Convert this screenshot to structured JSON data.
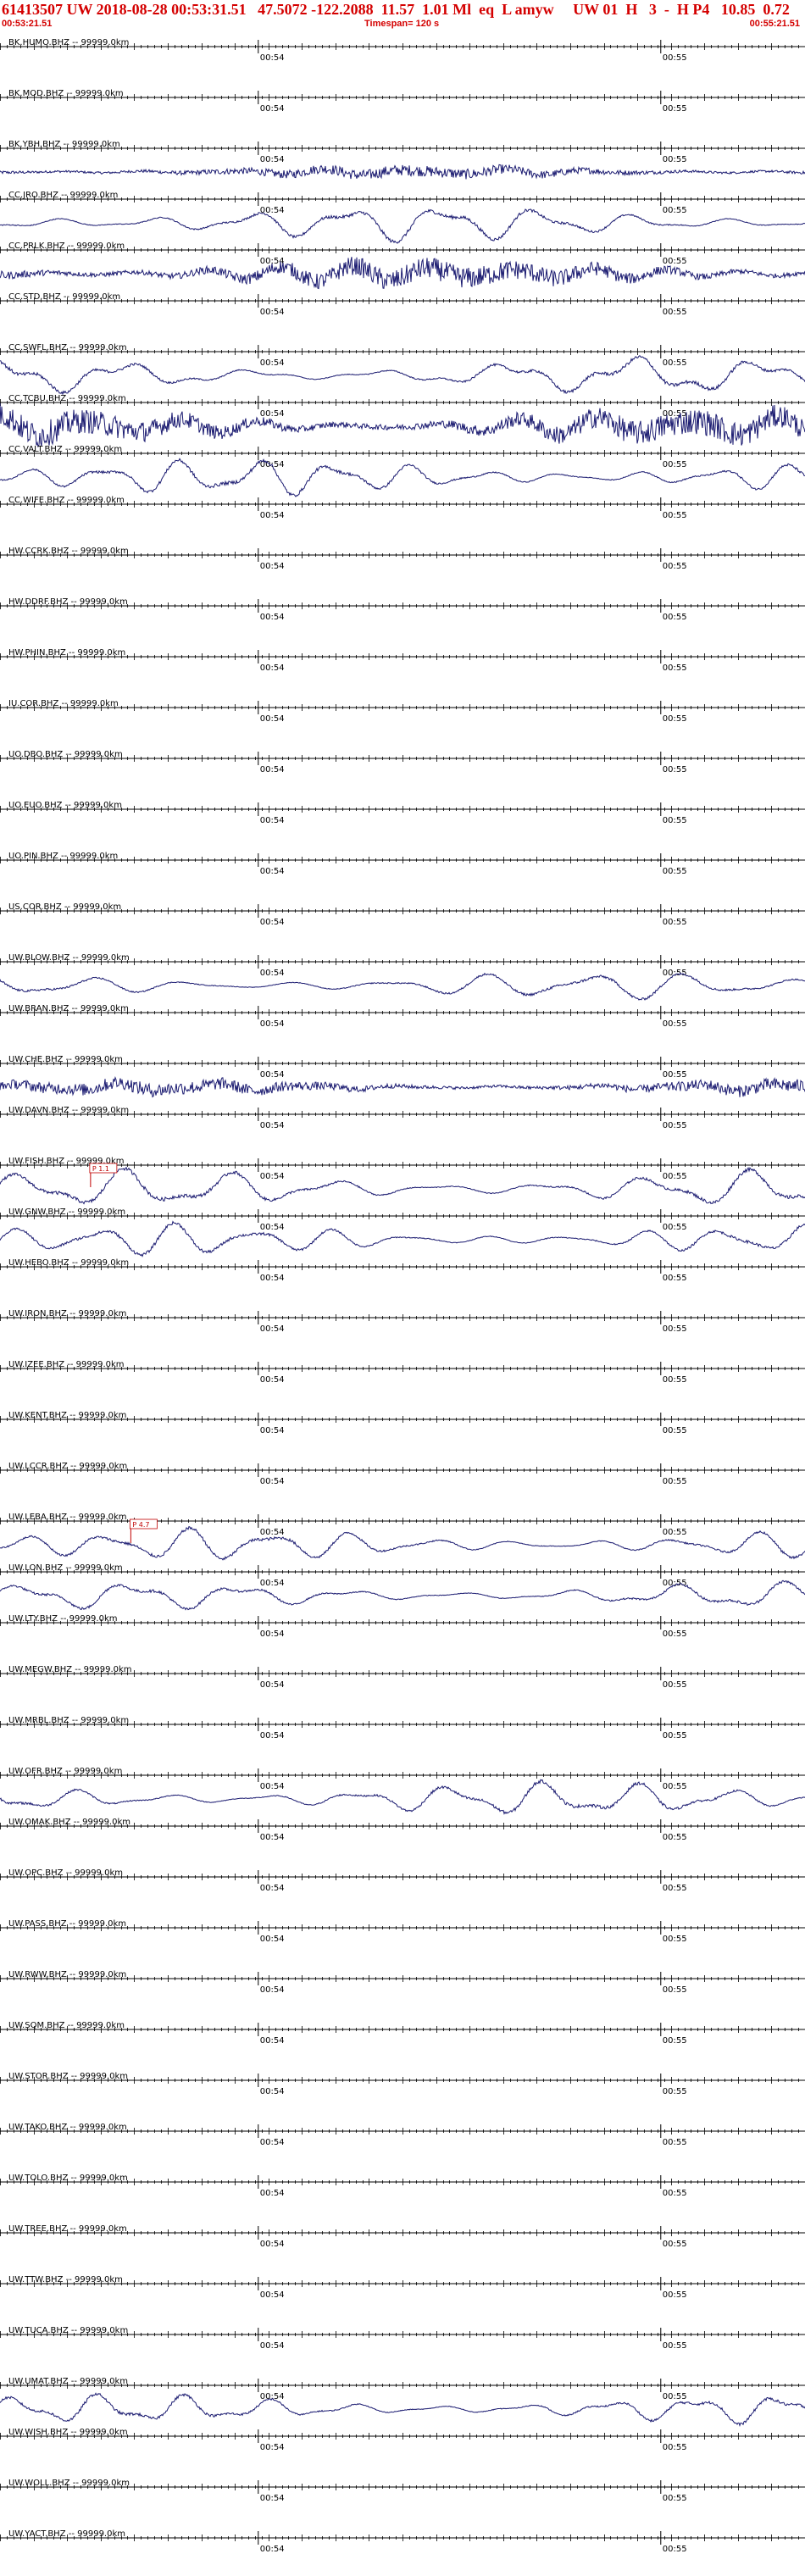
{
  "header": {
    "title": "61413507 UW 2018-08-28 00:53:31.51   47.5072 -122.2088  11.57  1.01 Ml  eq  L amyw     UW 01  H   3  -  H P4   10.85  0.72",
    "start_time": "00:53:21.51",
    "timespan": "Timespan= 120 s",
    "end_time": "00:55:21.51"
  },
  "colors": {
    "header_text": "#d40000",
    "trace": "#1a1a70",
    "axis": "#000000",
    "pick": "#c00000"
  },
  "chart_data": {
    "type": "line",
    "title": "61413507 UW 2018-08-28 00:53:31.51",
    "x_unit": "s",
    "x_range": [
      0,
      120
    ],
    "time_marks": [
      {
        "label": "00:54",
        "t": 38.5
      },
      {
        "label": "00:55",
        "t": 98.5
      }
    ],
    "series": [
      {
        "name": "BK.HUMO.BHZ -- 99999.0km",
        "active": false,
        "amp": 0,
        "style": ""
      },
      {
        "name": "BK.MOD.BHZ -- 99999.0km",
        "active": false,
        "amp": 0,
        "style": ""
      },
      {
        "name": "BK.YBH.BHZ -- 99999.0km",
        "active": true,
        "amp": 0.45,
        "style": "noisy"
      },
      {
        "name": "CC.JRO.BHZ -- 99999.0km",
        "active": true,
        "amp": 0.8,
        "style": "wave"
      },
      {
        "name": "CC.PRLK.BHZ -- 99999.0km",
        "active": true,
        "amp": 0.75,
        "style": "dense"
      },
      {
        "name": "CC.STD.BHZ -- 99999.0km",
        "active": false,
        "amp": 0,
        "style": ""
      },
      {
        "name": "CC.SWFL.BHZ -- 99999.0km",
        "active": true,
        "amp": 0.8,
        "style": "wave"
      },
      {
        "name": "CC.TCBU.BHZ -- 99999.0km",
        "active": true,
        "amp": 0.9,
        "style": "dense"
      },
      {
        "name": "CC.VALT.BHZ -- 99999.0km",
        "active": true,
        "amp": 0.8,
        "style": "wave"
      },
      {
        "name": "CC.WIFE.BHZ -- 99999.0km",
        "active": false,
        "amp": 0,
        "style": ""
      },
      {
        "name": "HW.CCRK.BHZ -- 99999.0km",
        "active": false,
        "amp": 0,
        "style": ""
      },
      {
        "name": "HW.DDRF.BHZ -- 99999.0km",
        "active": false,
        "amp": 0,
        "style": ""
      },
      {
        "name": "HW.PHIN.BHZ -- 99999.0km",
        "active": false,
        "amp": 0,
        "style": ""
      },
      {
        "name": "IU.COR.BHZ -- 99999.0km",
        "active": false,
        "amp": 0,
        "style": ""
      },
      {
        "name": "UO.DBO.BHZ -- 99999.0km",
        "active": false,
        "amp": 0,
        "style": ""
      },
      {
        "name": "UO.EUO.BHZ -- 99999.0km",
        "active": false,
        "amp": 0,
        "style": ""
      },
      {
        "name": "UO.PIN.BHZ -- 99999.0km",
        "active": false,
        "amp": 0,
        "style": ""
      },
      {
        "name": "US.COR.BHZ -- 99999.0km",
        "active": false,
        "amp": 0,
        "style": ""
      },
      {
        "name": "UW.BLOW.BHZ -- 99999.0km",
        "active": true,
        "amp": 0.6,
        "style": "wave"
      },
      {
        "name": "UW.BRAN.BHZ -- 99999.0km",
        "active": false,
        "amp": 0,
        "style": ""
      },
      {
        "name": "UW.CHE.BHZ -- 99999.0km",
        "active": true,
        "amp": 0.55,
        "style": "noisy"
      },
      {
        "name": "UW.DAVN.BHZ -- 99999.0km",
        "active": false,
        "amp": 0,
        "style": ""
      },
      {
        "name": "UW.FISH.BHZ -- 99999.0km",
        "active": true,
        "amp": 0.85,
        "style": "wave",
        "pick": "P 1.1",
        "pick_t": 13.5
      },
      {
        "name": "UW.GNW.BHZ -- 99999.0km",
        "active": true,
        "amp": 0.7,
        "style": "wave"
      },
      {
        "name": "UW.HEBO.BHZ -- 99999.0km",
        "active": false,
        "amp": 0,
        "style": ""
      },
      {
        "name": "UW.IRON.BHZ -- 99999.0km",
        "active": false,
        "amp": 0,
        "style": ""
      },
      {
        "name": "UW.IZEE.BHZ -- 99999.0km",
        "active": false,
        "amp": 0,
        "style": ""
      },
      {
        "name": "UW.KENT.BHZ -- 99999.0km",
        "active": false,
        "amp": 0,
        "style": ""
      },
      {
        "name": "UW.LCCR.BHZ -- 99999.0km",
        "active": false,
        "amp": 0,
        "style": ""
      },
      {
        "name": "UW.LEBA.BHZ -- 99999.0km",
        "active": true,
        "amp": 0.7,
        "style": "wave",
        "pick": "P 4.7",
        "pick_t": 19.5
      },
      {
        "name": "UW.LON.BHZ -- 99999.0km",
        "active": true,
        "amp": 0.6,
        "style": "wave"
      },
      {
        "name": "UW.LTY.BHZ -- 99999.0km",
        "active": false,
        "amp": 0,
        "style": ""
      },
      {
        "name": "UW.MEGW.BHZ -- 99999.0km",
        "active": false,
        "amp": 0,
        "style": ""
      },
      {
        "name": "UW.MRBL.BHZ -- 99999.0km",
        "active": false,
        "amp": 0,
        "style": ""
      },
      {
        "name": "UW.OFR.BHZ -- 99999.0km",
        "active": true,
        "amp": 0.75,
        "style": "wave"
      },
      {
        "name": "UW.OMAK.BHZ -- 99999.0km",
        "active": false,
        "amp": 0,
        "style": ""
      },
      {
        "name": "UW.OPC.BHZ -- 99999.0km",
        "active": false,
        "amp": 0,
        "style": ""
      },
      {
        "name": "UW.PASS.BHZ -- 99999.0km",
        "active": false,
        "amp": 0,
        "style": ""
      },
      {
        "name": "UW.RWW.BHZ -- 99999.0km",
        "active": false,
        "amp": 0,
        "style": ""
      },
      {
        "name": "UW.SQM.BHZ -- 99999.0km",
        "active": false,
        "amp": 0,
        "style": ""
      },
      {
        "name": "UW.STOR.BHZ -- 99999.0km",
        "active": false,
        "amp": 0,
        "style": ""
      },
      {
        "name": "UW.TAKO.BHZ -- 99999.0km",
        "active": false,
        "amp": 0,
        "style": ""
      },
      {
        "name": "UW.TOLO.BHZ -- 99999.0km",
        "active": false,
        "amp": 0,
        "style": ""
      },
      {
        "name": "UW.TREE.BHZ -- 99999.0km",
        "active": false,
        "amp": 0,
        "style": ""
      },
      {
        "name": "UW.TTW.BHZ -- 99999.0km",
        "active": false,
        "amp": 0,
        "style": ""
      },
      {
        "name": "UW.TUCA.BHZ -- 99999.0km",
        "active": false,
        "amp": 0,
        "style": ""
      },
      {
        "name": "UW.UMAT.BHZ -- 99999.0km",
        "active": true,
        "amp": 0.65,
        "style": "wave"
      },
      {
        "name": "UW.WISH.BHZ -- 99999.0km",
        "active": false,
        "amp": 0,
        "style": ""
      },
      {
        "name": "UW.WOLL.BHZ -- 99999.0km",
        "active": false,
        "amp": 0,
        "style": ""
      },
      {
        "name": "UW.YACT.BHZ -- 99999.0km",
        "active": false,
        "amp": 0,
        "style": ""
      }
    ]
  }
}
